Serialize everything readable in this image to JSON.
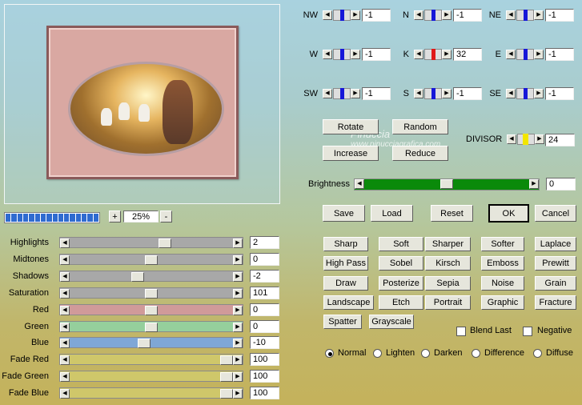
{
  "zoom": {
    "minus": "-",
    "plus": "+",
    "value": "25%"
  },
  "progress_segments": 16,
  "watermark": {
    "line1": "Pinuccia",
    "line2": "www.pinucciagrafica.com"
  },
  "sliders": [
    {
      "label": "Highlights",
      "value": "2",
      "color": "#a8a8a8",
      "level": 0.59
    },
    {
      "label": "Midtones",
      "value": "0",
      "color": "#a8a8a8",
      "level": 0.5
    },
    {
      "label": "Shadows",
      "value": "-2",
      "color": "#a8a8a8",
      "level": 0.41
    },
    {
      "label": "Saturation",
      "value": "101",
      "color": "#a8a8a8",
      "level": 0.5
    },
    {
      "label": "Red",
      "value": "0",
      "color": "#d09a9a",
      "level": 0.5
    },
    {
      "label": "Green",
      "value": "0",
      "color": "#95cf9c",
      "level": 0.5
    },
    {
      "label": "Blue",
      "value": "-10",
      "color": "#7fa7d6",
      "level": 0.45
    },
    {
      "label": "Fade Red",
      "value": "100",
      "color": "#cfc76a",
      "level": 1.0
    },
    {
      "label": "Fade Green",
      "value": "100",
      "color": "#cfc76a",
      "level": 1.0
    },
    {
      "label": "Fade Blue",
      "value": "100",
      "color": "#cfc76a",
      "level": 1.0
    }
  ],
  "kernel": {
    "cells": [
      {
        "label": "NW",
        "value": "-1"
      },
      {
        "label": "N",
        "value": "-1"
      },
      {
        "label": "NE",
        "value": "-1"
      },
      {
        "label": "W",
        "value": "-1"
      },
      {
        "label": "K",
        "value": "32"
      },
      {
        "label": "E",
        "value": "-1"
      },
      {
        "label": "SW",
        "value": "-1"
      },
      {
        "label": "S",
        "value": "-1"
      },
      {
        "label": "SE",
        "value": "-1"
      }
    ],
    "center_color": "#e01818",
    "normal_color": "#1717d8"
  },
  "top_buttons": {
    "rotate": "Rotate",
    "random": "Random",
    "increase": "Increase",
    "reduce": "Reduce"
  },
  "divisor": {
    "label": "DIVISOR",
    "value": "24",
    "color": "#f2e600"
  },
  "brightness": {
    "label": "Brightness",
    "value": "0",
    "color": "#0a8a0a",
    "level": 0.5
  },
  "actions": {
    "save": "Save",
    "load": "Load",
    "reset": "Reset",
    "ok": "OK",
    "cancel": "Cancel"
  },
  "presets": [
    [
      "Sharp",
      "Soft",
      "Sharper",
      "Softer",
      "Laplace"
    ],
    [
      "High Pass",
      "Sobel",
      "Kirsch",
      "Emboss",
      "Prewitt"
    ],
    [
      "Draw",
      "Posterize",
      "Sepia",
      "Noise",
      "Grain"
    ],
    [
      "Landscape",
      "Etch",
      "Portrait",
      "Graphic",
      "Fracture"
    ],
    [
      "Spatter",
      "Grayscale"
    ]
  ],
  "options": {
    "blend_last": "Blend Last",
    "negative": "Negative"
  },
  "modes": [
    "Normal",
    "Lighten",
    "Darken",
    "Difference",
    "Diffuse"
  ],
  "selected_mode": "Normal"
}
